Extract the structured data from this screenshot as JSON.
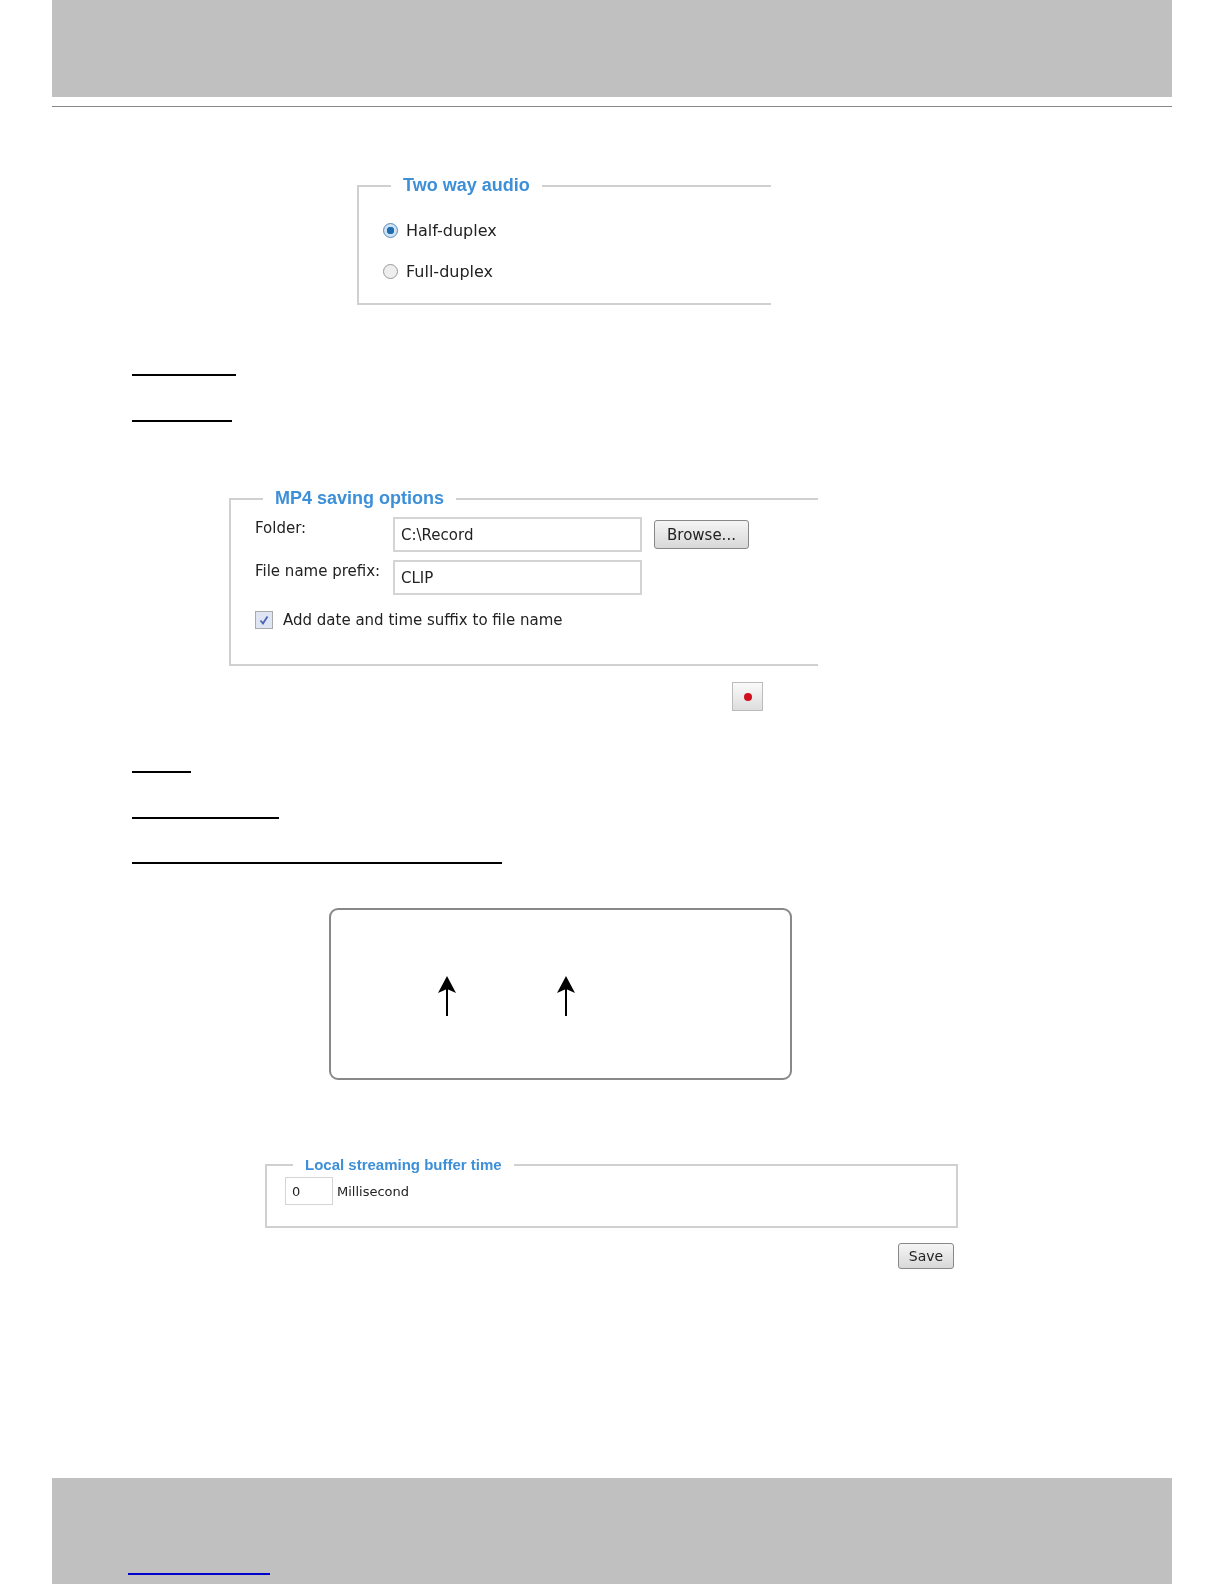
{
  "two_way_audio": {
    "title": "Two way audio",
    "options": [
      {
        "label": "Half-duplex",
        "selected": true
      },
      {
        "label": "Full-duplex",
        "selected": false
      }
    ]
  },
  "mp4_saving_options": {
    "title": "MP4 saving options",
    "folder": {
      "label": "Folder:",
      "value": "C:\\Record"
    },
    "browse_button": "Browse...",
    "file_name_prefix": {
      "label": "File name prefix:",
      "value": "CLIP"
    },
    "date_suffix": {
      "label": "Add date and time suffix to file name",
      "checked": true
    }
  },
  "local_streaming_buffer": {
    "title": "Local streaming buffer time",
    "value": "0",
    "unit": "Millisecond"
  },
  "save_button": "Save"
}
